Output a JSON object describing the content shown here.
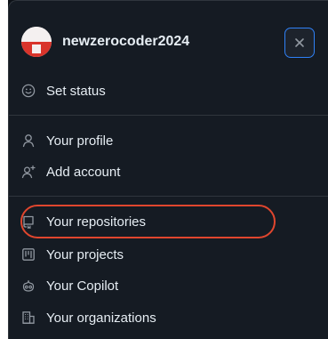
{
  "user": {
    "username": "newzerocoder2024"
  },
  "close_button": {
    "label": "×"
  },
  "menu": {
    "status": {
      "label": "Set status",
      "icon": "smiley-icon"
    },
    "account": [
      {
        "label": "Your profile",
        "icon": "person-icon"
      },
      {
        "label": "Add account",
        "icon": "person-add-icon"
      }
    ],
    "links": [
      {
        "label": "Your repositories",
        "icon": "repo-icon"
      },
      {
        "label": "Your projects",
        "icon": "project-icon"
      },
      {
        "label": "Your Copilot",
        "icon": "copilot-icon"
      },
      {
        "label": "Your organizations",
        "icon": "organization-icon"
      }
    ]
  },
  "colors": {
    "background": "#151b23",
    "text": "#e6edf3",
    "icon": "#9198a1",
    "focus_ring": "#2f81f7",
    "annotation": "#e0462e"
  }
}
